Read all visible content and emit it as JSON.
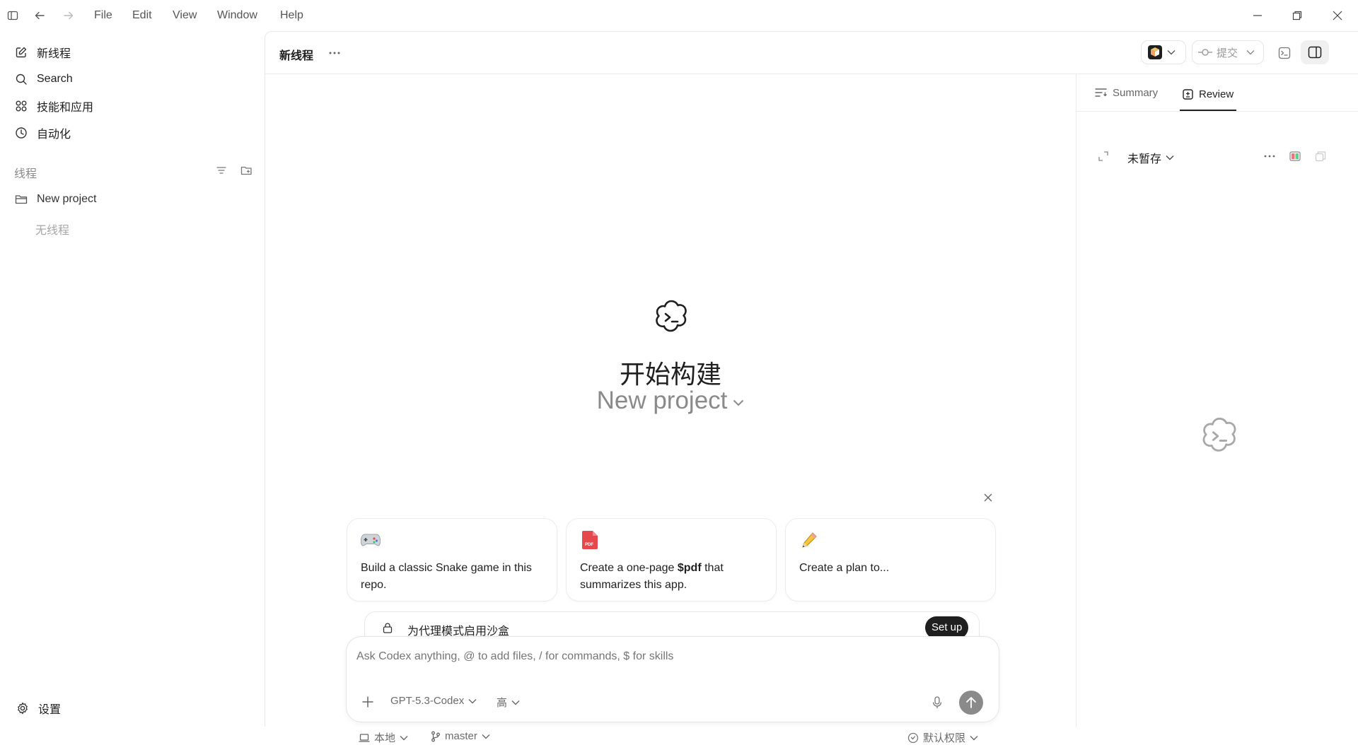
{
  "titlebar": {
    "menu": [
      "File",
      "Edit",
      "View",
      "Window",
      "Help"
    ]
  },
  "sidebar": {
    "nav": [
      {
        "label": "新线程",
        "icon": "edit-icon"
      },
      {
        "label": "Search",
        "icon": "search-icon"
      },
      {
        "label": "技能和应用",
        "icon": "grid-icon"
      },
      {
        "label": "自动化",
        "icon": "clock-icon"
      }
    ],
    "section_title": "线程",
    "project_name": "New project",
    "empty_text": "无线程",
    "settings_label": "设置"
  },
  "header": {
    "thread_title": "新线程",
    "commit_label": "提交"
  },
  "hero": {
    "title": "开始构建",
    "project": "New project"
  },
  "suggestions": [
    {
      "parts": [
        "Build a classic Snake game in this repo."
      ],
      "icon": "gamepad-icon"
    },
    {
      "parts": [
        "Create a one-page ",
        "$pdf",
        " that summarizes this app."
      ],
      "icon": "pdf-icon"
    },
    {
      "parts": [
        "Create a plan to..."
      ],
      "icon": "pencil-icon"
    }
  ],
  "sandbox_banner": {
    "text": "为代理模式启用沙盒",
    "button": "Set up"
  },
  "composer": {
    "placeholder": "Ask Codex anything, @ to add files, / for commands, $ for skills",
    "model": "GPT-5.3-Codex",
    "effort": "高"
  },
  "footer": {
    "location": "本地",
    "branch": "master",
    "permissions": "默认权限"
  },
  "right_panel": {
    "tabs": [
      "Summary",
      "Review"
    ],
    "active_tab": "Review",
    "stash_label": "未暂存"
  },
  "colors": {
    "accent": "#1f1f1f",
    "muted": "#8a8a8a",
    "border": "#e8e8e8",
    "pdf_red": "#e5484d"
  }
}
